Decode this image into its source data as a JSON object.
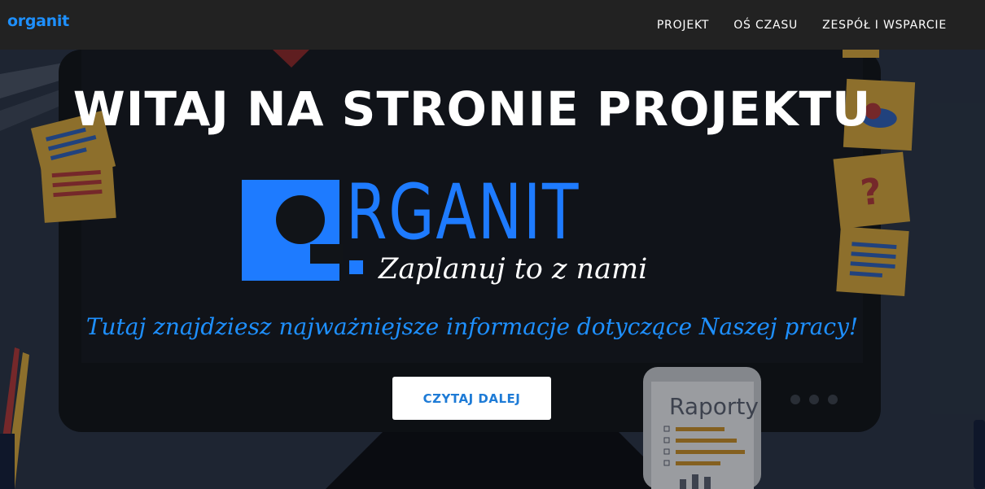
{
  "navbar": {
    "brand": "organit",
    "links": [
      "PROJEKT",
      "OŚ CZASU",
      "ZESPÓŁ I WSPARCIE"
    ]
  },
  "hero": {
    "title": "WITAJ NA STRONIE PROJEKTU",
    "logo_word": "RGANIT",
    "logo_tagline": "Zaplanuj to z nami",
    "subtitle": "Tutaj znajdziesz najważniejsze informacje dotyczące Naszej pracy!",
    "cta_label": "CZYTAJ DALEJ",
    "phone_label": "Raporty",
    "sticky_note_symbol": "?"
  },
  "colors": {
    "navbar_bg": "#222222",
    "accent": "#1e90ff",
    "logo_blue": "#1e7bff",
    "sticky_note": "#f2c25a"
  }
}
